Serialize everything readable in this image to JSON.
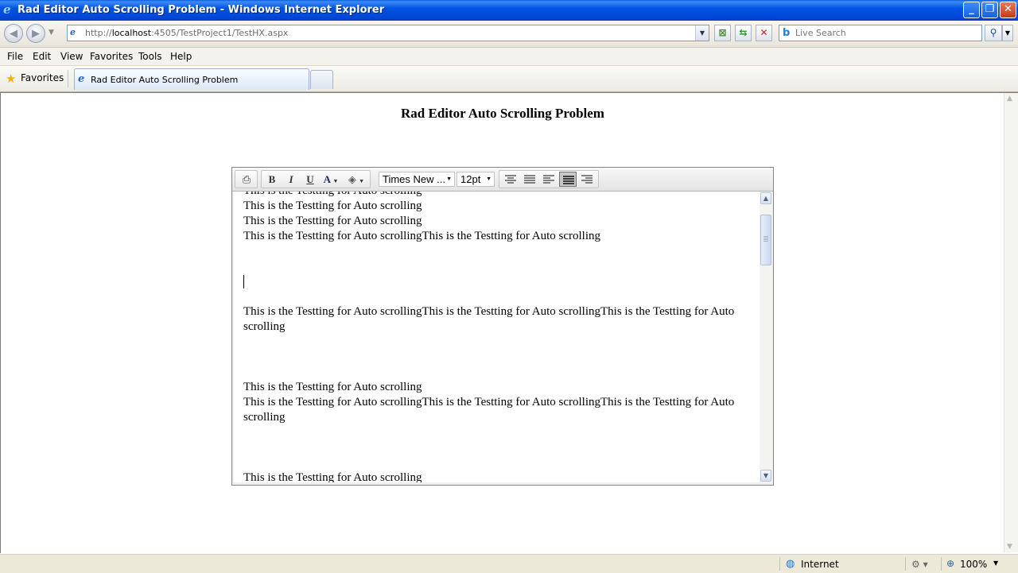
{
  "window": {
    "title": "Rad Editor Auto Scrolling Problem - Windows Internet Explorer",
    "controls": {
      "minimize": "_",
      "maximize": "❐",
      "close": "✕"
    }
  },
  "address_bar": {
    "url_prefix": "http://",
    "url_host": "localhost",
    "url_rest": ":4505/TestProject1/TestHX.aspx",
    "search_placeholder": "Live Search"
  },
  "menu": [
    "File",
    "Edit",
    "View",
    "Favorites",
    "Tools",
    "Help"
  ],
  "favorites_bar": {
    "label": "Favorites",
    "active_tab": "Rad Editor Auto Scrolling Problem"
  },
  "page": {
    "heading": "Rad Editor Auto Scrolling Problem"
  },
  "editor": {
    "toolbar": {
      "font_name": "Times New ...",
      "font_size": "12pt",
      "bold": "B",
      "italic": "I",
      "underline": "U",
      "forecolor": "A",
      "active_align": "justify"
    },
    "lines": [
      "This is the Testting for Auto scrolling",
      "This is the Testting for Auto scrolling",
      "This is the Testting for Auto scrolling",
      "This is the Testting for Auto scrollingThis is the Testting for Auto scrolling",
      "This is the Testting for Auto scrollingThis is the Testting for Auto scrollingThis is the Testting for Auto",
      "scrolling",
      "This is the Testting for Auto scrolling",
      "This is the Testting for Auto scrollingThis is the Testting for Auto scrollingThis is the Testting for Auto",
      "scrolling",
      "This is the Testting for Auto scrolling"
    ]
  },
  "status_bar": {
    "zone": "Internet",
    "zoom": "100%"
  },
  "icons": {
    "ie": "ie-logo-icon",
    "favorites": "star-icon",
    "search": "magnifier-icon",
    "zone": "globe-icon"
  },
  "colors": {
    "titlebar": "#0054e3",
    "close_button": "#c63a16"
  }
}
